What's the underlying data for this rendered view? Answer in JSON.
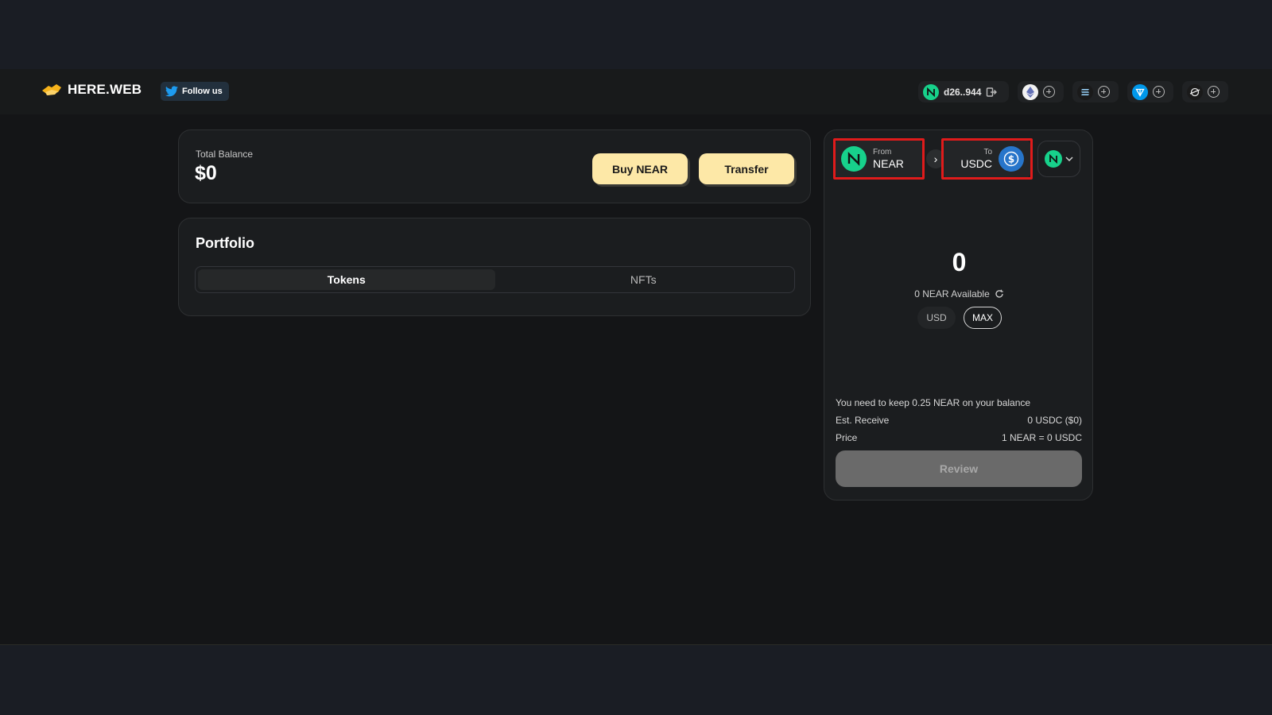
{
  "header": {
    "logo_text": "HERE.WEB",
    "follow_label": "Follow us",
    "account_label": "d26..944",
    "chains": [
      {
        "icon": "near-icon",
        "color": "#17d18b"
      },
      {
        "icon": "ethereum-icon",
        "color": "#f2f2f2"
      },
      {
        "icon": "solana-icon",
        "color": "#1a1a1a"
      },
      {
        "icon": "ton-icon",
        "color": "#0098ea"
      },
      {
        "icon": "stellar-icon",
        "color": "#1a1a1a"
      }
    ]
  },
  "balance": {
    "label": "Total Balance",
    "value": "$0",
    "buy_label": "Buy NEAR",
    "transfer_label": "Transfer"
  },
  "portfolio": {
    "title": "Portfolio",
    "tabs": [
      "Tokens",
      "NFTs"
    ],
    "active_tab": "Tokens"
  },
  "swap": {
    "from_label": "From",
    "from_token": "NEAR",
    "to_label": "To",
    "to_token": "USDC",
    "amount": "0",
    "available": "0 NEAR Available",
    "usd_label": "USD",
    "max_label": "MAX",
    "keep_note": "You need to keep 0.25 NEAR on your balance",
    "est_receive_label": "Est. Receive",
    "est_receive_value": "0 USDC ($0)",
    "price_label": "Price",
    "price_value": "1 NEAR = 0 USDC",
    "review_label": "Review"
  },
  "colors": {
    "accent_yellow": "#fde8a7",
    "near_green": "#17d18b",
    "usdc_blue": "#2775ca",
    "highlight_red": "#e01b1b"
  }
}
